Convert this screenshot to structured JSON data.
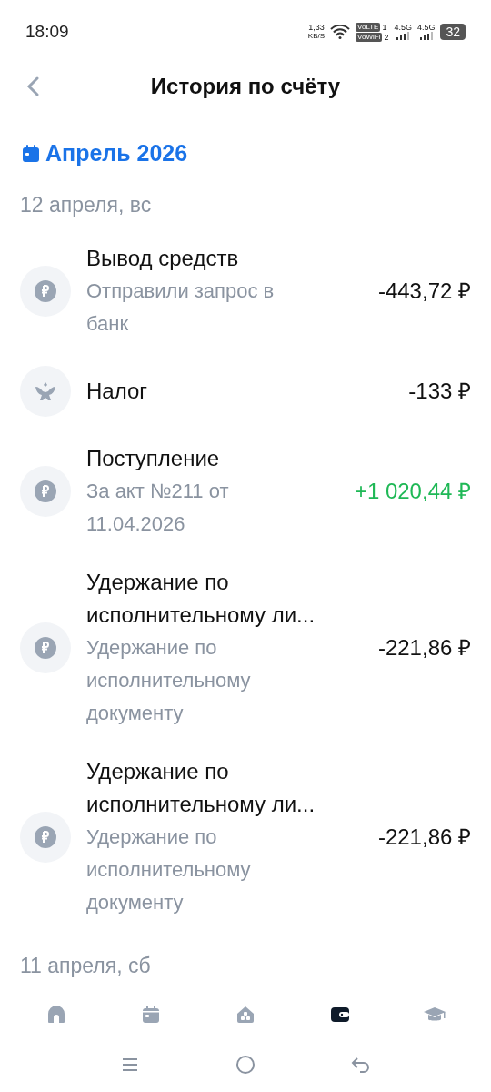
{
  "status_bar": {
    "time": "18:09",
    "speed": "1,33",
    "speed_unit": "KB/S",
    "volte": "VoLTE",
    "sim_1": "1",
    "vowifi": "VoWiFi",
    "sim_2": "2",
    "network_1": "4.5G",
    "network_2": "4.5G",
    "battery": "32"
  },
  "header": {
    "title": "История по счёту"
  },
  "month": "Апрель 2026",
  "days": [
    {
      "date": "12 апреля, вс",
      "transactions": [
        {
          "kind": "ruble",
          "title": "Вывод средств",
          "subtitle": "Отправили запрос в банк",
          "amount": "-443,72 ₽",
          "income": false
        },
        {
          "kind": "emblem",
          "title": "Налог",
          "amount": "-133 ₽",
          "income": false
        },
        {
          "kind": "ruble",
          "title": "Поступление",
          "subtitle": "За акт №211 от 11.04.2026",
          "amount": "+1 020,44 ₽",
          "income": true
        },
        {
          "kind": "ruble",
          "title": "Удержание по исполнительному ли...",
          "subtitle": "Удержание по исполнительному документу",
          "amount": "-221,86 ₽",
          "income": false
        },
        {
          "kind": "ruble",
          "title": "Удержание по исполнительному ли...",
          "subtitle": "Удержание по исполнительному документу",
          "amount": "-221,86 ₽",
          "income": false
        }
      ]
    },
    {
      "date": "11 апреля, сб"
    }
  ],
  "tab_bar": [
    {
      "kind": "home",
      "selected": false
    },
    {
      "kind": "calendar",
      "selected": false
    },
    {
      "kind": "boxes",
      "selected": false
    },
    {
      "kind": "wallet",
      "selected": true
    },
    {
      "kind": "cap",
      "selected": false
    }
  ]
}
